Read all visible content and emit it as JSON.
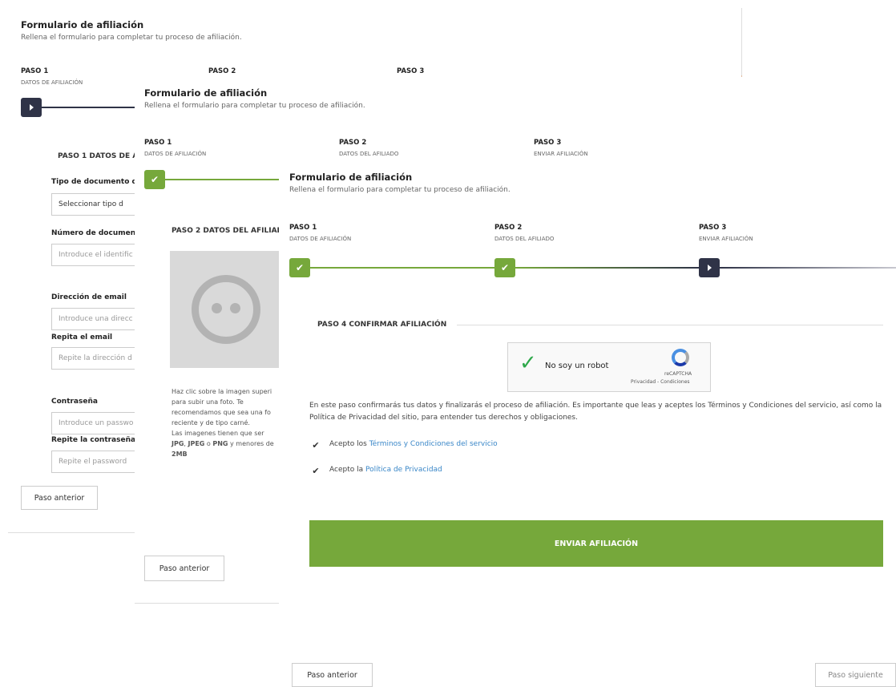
{
  "form": {
    "title": "Formulario de afiliación",
    "subtitle": "Rellena el formulario para completar tu proceso de afiliación."
  },
  "steps": [
    {
      "label": "PASO 1",
      "sub": "DATOS DE AFILIACIÓN"
    },
    {
      "label": "PASO 2",
      "sub": "DATOS DEL AFILIADO"
    },
    {
      "label": "PASO 3",
      "sub": "ENVIAR AFILIACIÓN"
    }
  ],
  "layer1": {
    "section_title": "PASO 1 DATOS DE A",
    "doc_type_label": "Tipo de documento d",
    "doc_type_select": "Seleccionar tipo d",
    "doc_number_label": "Número de documen",
    "doc_number_placeholder": "Introduce el identific",
    "email_label": "Dirección de email",
    "email_placeholder": "Introduce una direcc",
    "email_repeat_label": "Repita el email",
    "email_repeat_placeholder": "Repite la dirección d",
    "password_label": "Contraseña",
    "password_placeholder": "Introduce un passwo",
    "password_repeat_label": "Repite la contraseña",
    "password_repeat_placeholder": "Repite el password",
    "prev_button": "Paso anterior"
  },
  "layer2": {
    "section_title": "PASO 2 DATOS DEL AFILIAD",
    "photo_help": [
      "Haz clic sobre la imagen superi",
      "para subir una foto. Te",
      "recomendamos que sea una fo",
      "reciente y de tipo carné.",
      "Las imagenes tienen que ser"
    ],
    "formats_jpg": "JPG",
    "formats_sep1": ", ",
    "formats_jpeg": "JPEG",
    "formats_sep2": " o ",
    "formats_png": "PNG",
    "formats_tail": " y menores de",
    "formats_size": "2MB",
    "prev_button": "Paso anterior"
  },
  "layer3": {
    "section_title": "PASO 4 CONFIRMAR AFILIACIÓN",
    "captcha": {
      "label": "No soy un robot",
      "brand": "reCAPTCHA",
      "links": "Privacidad - Condiciones"
    },
    "info_text": "En este paso confirmarás tus datos y finalizarás el proceso de afiliación. Es importante que leas y aceptes los Términos y Condiciones del servicio, así como la Política de Privacidad del sitio, para entender tus derechos y obligaciones.",
    "terms_prefix": "Acepto los ",
    "terms_link": "Términos y Condiciones del servicio",
    "privacy_prefix": "Acepto la ",
    "privacy_link": "Política de Privacidad",
    "submit_button": "ENVIAR AFILIACIÓN",
    "prev_button": "Paso anterior",
    "next_button": "Paso siguiente"
  },
  "colors": {
    "green": "#76a83b",
    "dark": "#2f3347",
    "link": "#3a87c8"
  }
}
